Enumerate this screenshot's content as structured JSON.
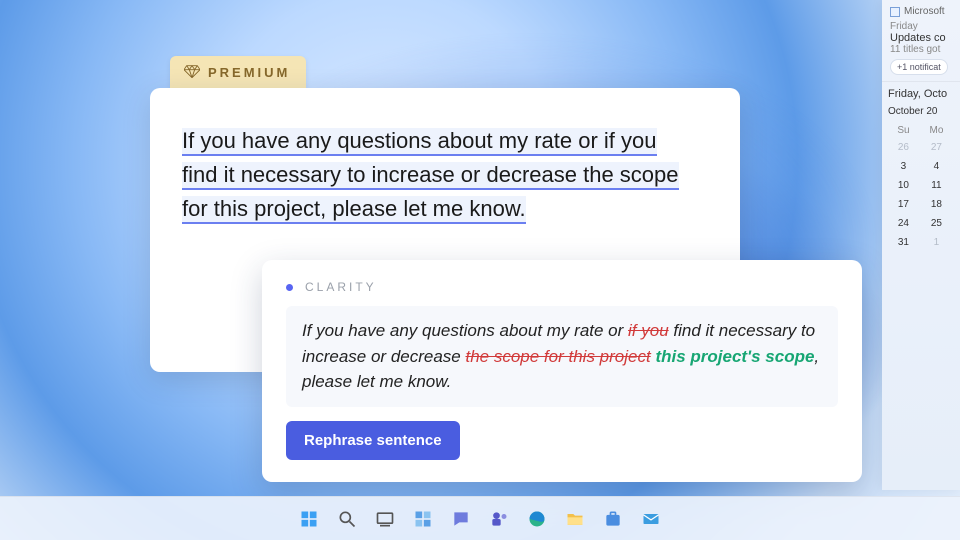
{
  "premium": {
    "label": "PREMIUM"
  },
  "editor": {
    "text_plain": "If you have any questions about my rate or if you find it necessary to increase or decrease the scope for this project, please let me know.",
    "underline_segments": [
      "If you have any questions about my rate or if you",
      "find it necessary to increase or decrease the scope",
      "for this project, please let me know."
    ]
  },
  "suggestion": {
    "category": "CLARITY",
    "dot_color": "#5865f2",
    "segments": [
      {
        "t": "If you have any questions about my rate or ",
        "kind": "plain"
      },
      {
        "t": "if you",
        "kind": "strike"
      },
      {
        "t": " find it necessary to increase or decrease ",
        "kind": "plain"
      },
      {
        "t": "the scope for this project",
        "kind": "strike"
      },
      {
        "t": " ",
        "kind": "plain"
      },
      {
        "t": "this project's scope",
        "kind": "insert"
      },
      {
        "t": ", please let me know.",
        "kind": "plain"
      }
    ],
    "button_label": "Rephrase sentence"
  },
  "widgets": {
    "news": {
      "source": "Microsoft",
      "day": "Friday",
      "headline": "Updates co",
      "subline": "11 titles got"
    },
    "notification_chip": "+1 notificat",
    "calendar": {
      "date_line": "Friday, Octo",
      "month_line": "October 20",
      "dow": [
        "Su",
        "Mo"
      ],
      "rows": [
        [
          {
            "n": "26",
            "dim": true
          },
          {
            "n": "27",
            "dim": true
          }
        ],
        [
          {
            "n": "3"
          },
          {
            "n": "4"
          }
        ],
        [
          {
            "n": "10"
          },
          {
            "n": "11"
          }
        ],
        [
          {
            "n": "17"
          },
          {
            "n": "18"
          }
        ],
        [
          {
            "n": "24"
          },
          {
            "n": "25"
          }
        ],
        [
          {
            "n": "31"
          },
          {
            "n": "1",
            "dim": true
          }
        ]
      ]
    }
  },
  "taskbar": {
    "icons": [
      "start",
      "search",
      "taskview",
      "widgets",
      "chat",
      "teams",
      "edge",
      "explorer",
      "store",
      "mail"
    ]
  }
}
